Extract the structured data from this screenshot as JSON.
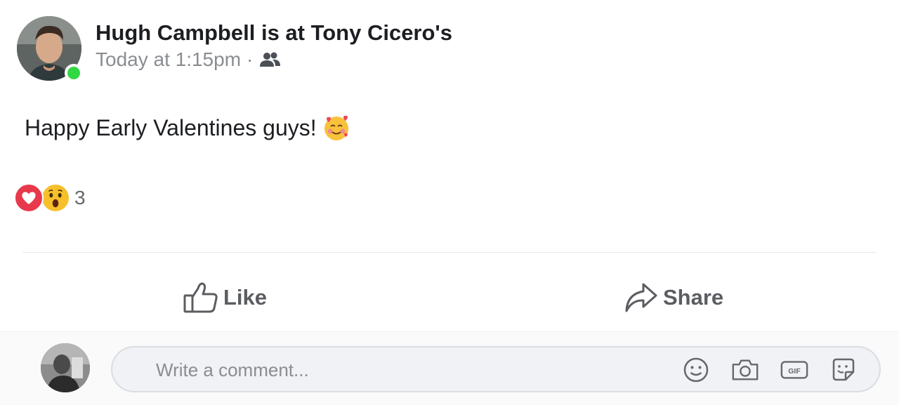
{
  "post": {
    "author_line": "Hugh Campbell is at Tony Cicero's",
    "timestamp": "Today at 1:15pm",
    "meta_separator": "·",
    "audience_icon": "friends-icon",
    "body": "Happy Early Valentines guys!",
    "body_emoji": "smiling-face-with-hearts-emoji",
    "online_status_color": "#31d843"
  },
  "reactions": {
    "types": [
      "love",
      "wow"
    ],
    "count": "3"
  },
  "actions": {
    "like_label": "Like",
    "share_label": "Share"
  },
  "comment": {
    "placeholder": "Write a comment...",
    "tools": [
      "emoji-icon",
      "camera-icon",
      "gif-icon",
      "sticker-icon"
    ]
  }
}
